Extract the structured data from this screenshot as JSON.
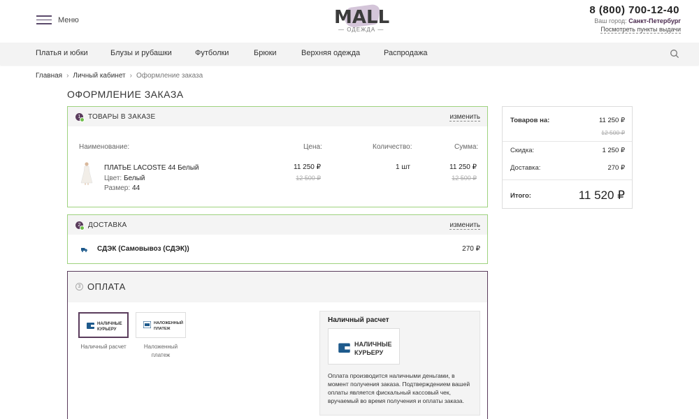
{
  "header": {
    "menu_label": "Меню",
    "logo_text": "MALL",
    "logo_sub": "— ОДЕЖДА —",
    "phone": "8 (800) 700-12-40",
    "city_prefix": "Ваш город:",
    "city": "Санкт-Петербург",
    "pickup_link": "Посмотреть пункты выдачи"
  },
  "nav": {
    "items": [
      "Платья и юбки",
      "Блузы и рубашки",
      "Футболки",
      "Брюки",
      "Верхняя одежда",
      "Распродажа"
    ],
    "search_icon": "search-icon"
  },
  "breadcrumb": [
    "Главная",
    "Личный кабинет",
    "Оформление заказа"
  ],
  "page_title": "ОФОРМЛЕНИЕ ЗАКАЗА",
  "goods": {
    "step": "1",
    "title": "ТОВАРЫ В ЗАКАЗЕ",
    "change": "изменить",
    "columns": [
      "Наименование:",
      "Цена:",
      "Количество:",
      "Сумма:"
    ],
    "item": {
      "name": "ПЛАТЬЕ LACOSTE 44 Белый",
      "color_label": "Цвет:",
      "color": "Белый",
      "size_label": "Размер:",
      "size": "44",
      "price": "11 250 ₽",
      "price_old": "12 500 ₽",
      "qty": "1 шт",
      "sum": "11 250 ₽",
      "sum_old": "12 500 ₽"
    }
  },
  "delivery": {
    "step": "2",
    "title": "ДОСТАВКА",
    "change": "изменить",
    "name": "СДЭК (Самовывоз (СДЭК))",
    "price": "270 ₽"
  },
  "payment": {
    "step": "3",
    "title": "ОПЛАТА",
    "options": [
      {
        "icon_text": "НАЛИЧНЫЕ\nКУРЬЕРУ",
        "caption": "Наличный расчет",
        "selected": true
      },
      {
        "icon_text": "НАЛОЖЕННЫЙ\nПЛАТЕЖ",
        "caption": "Наложенный\nплатеж",
        "selected": false
      }
    ],
    "detail_title": "Наличный расчет",
    "detail_card": "НАЛИЧНЫЕ\nКУРЬЕРУ",
    "detail_desc": "Оплата производится наличными деньгами, в момент получения заказа. Подтверждением вашей оплаты является фискальный кассовый чек, вручаемый во время получения и оплаты заказа."
  },
  "summary": {
    "goods_label": "Товаров на:",
    "goods_value": "11 250 ₽",
    "goods_old": "12 500 ₽",
    "discount_label": "Скидка:",
    "discount_value": "1 250 ₽",
    "delivery_label": "Доставка:",
    "delivery_value": "270 ₽",
    "total_label": "Итого:",
    "total_value": "11 520 ₽"
  },
  "colors": {
    "accent": "#5a3c5c",
    "done_border": "#9ed27e",
    "check": "#6fbe4a",
    "wallet": "#1e5a8c"
  }
}
